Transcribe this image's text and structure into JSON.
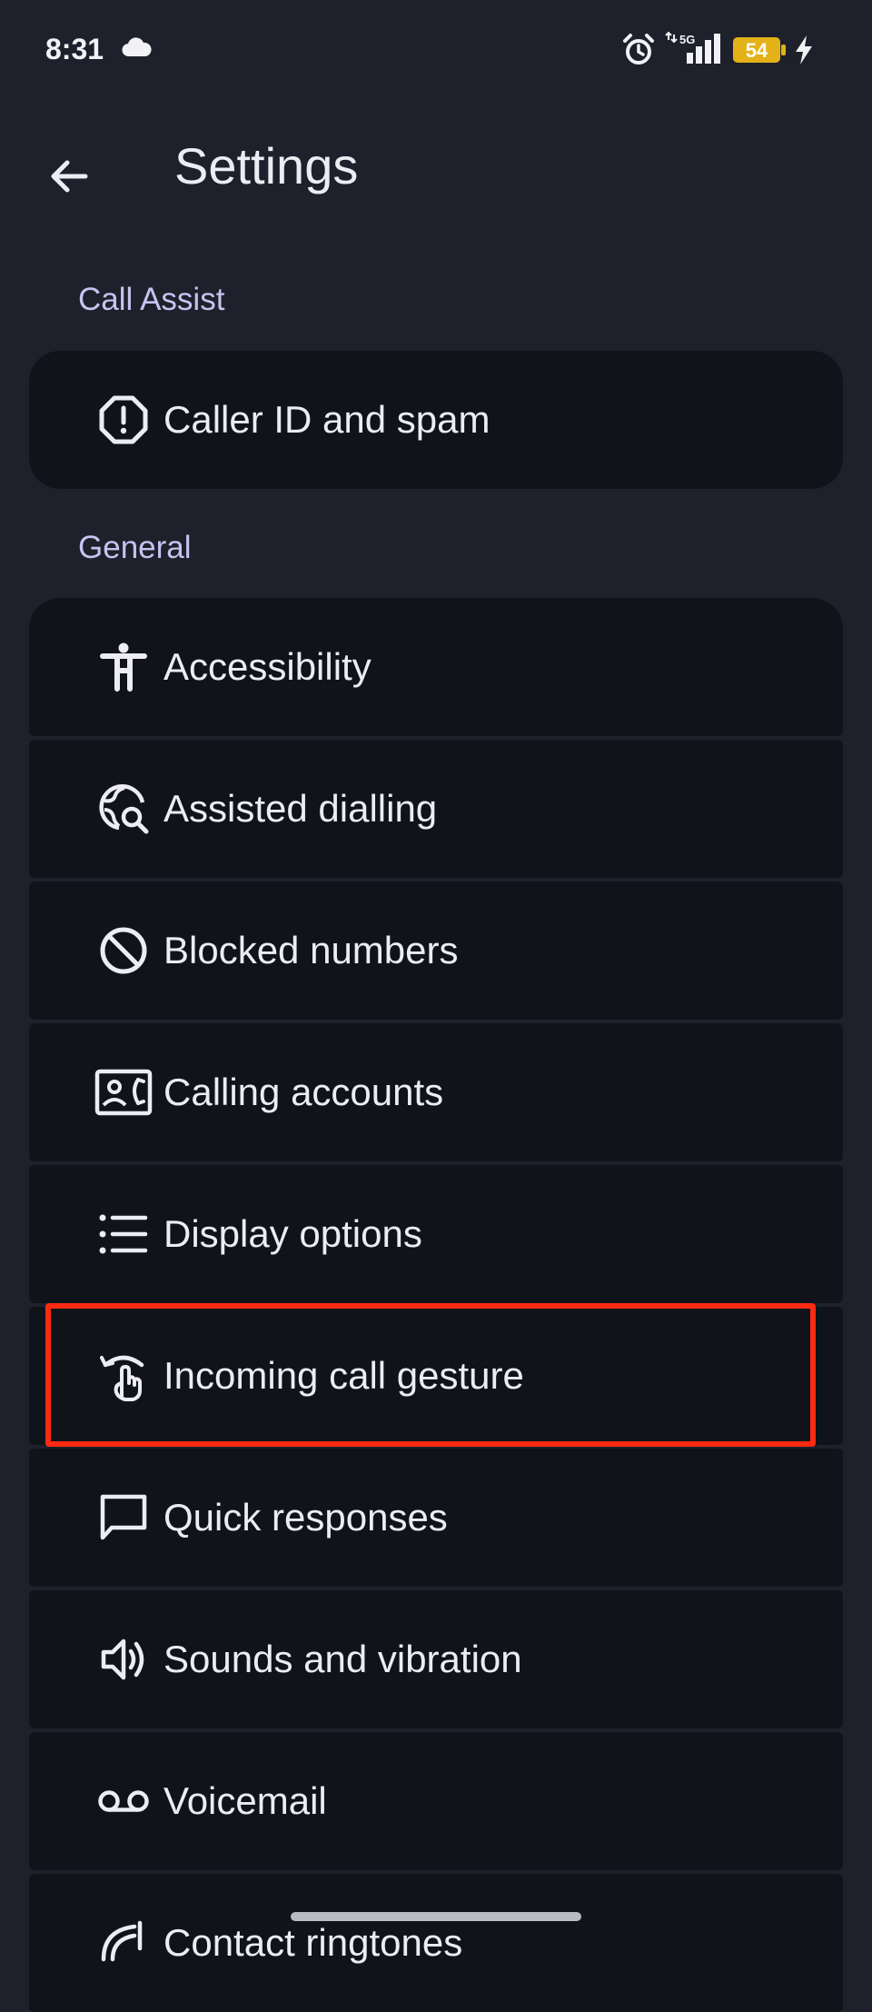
{
  "status_bar": {
    "time": "8:31",
    "network": "5G",
    "battery_level": "54",
    "icons": [
      "cloud-icon",
      "alarm-icon",
      "signal-icon",
      "battery-icon",
      "charging-icon"
    ]
  },
  "app_bar": {
    "title": "Settings",
    "back_icon": "back-arrow-icon"
  },
  "sections": [
    {
      "header": "Call Assist",
      "items": [
        {
          "label": "Caller ID and spam",
          "icon": "alert-octagon-icon"
        }
      ]
    },
    {
      "header": "General",
      "items": [
        {
          "label": "Accessibility",
          "icon": "accessibility-icon"
        },
        {
          "label": "Assisted dialling",
          "icon": "globe-search-icon"
        },
        {
          "label": "Blocked numbers",
          "icon": "block-icon"
        },
        {
          "label": "Calling accounts",
          "icon": "contact-phone-icon"
        },
        {
          "label": "Display options",
          "icon": "list-icon"
        },
        {
          "label": "Incoming call gesture",
          "icon": "swipe-gesture-icon"
        },
        {
          "label": "Quick responses",
          "icon": "chat-bubble-icon"
        },
        {
          "label": "Sounds and vibration",
          "icon": "speaker-icon"
        },
        {
          "label": "Voicemail",
          "icon": "voicemail-icon"
        },
        {
          "label": "Contact ringtones",
          "icon": "contact-ringtone-icon"
        }
      ]
    }
  ],
  "colors": {
    "background": "#1e202b",
    "card": "#11131a",
    "section_header": "#c9c2f0",
    "highlight": "#ff2a12"
  }
}
